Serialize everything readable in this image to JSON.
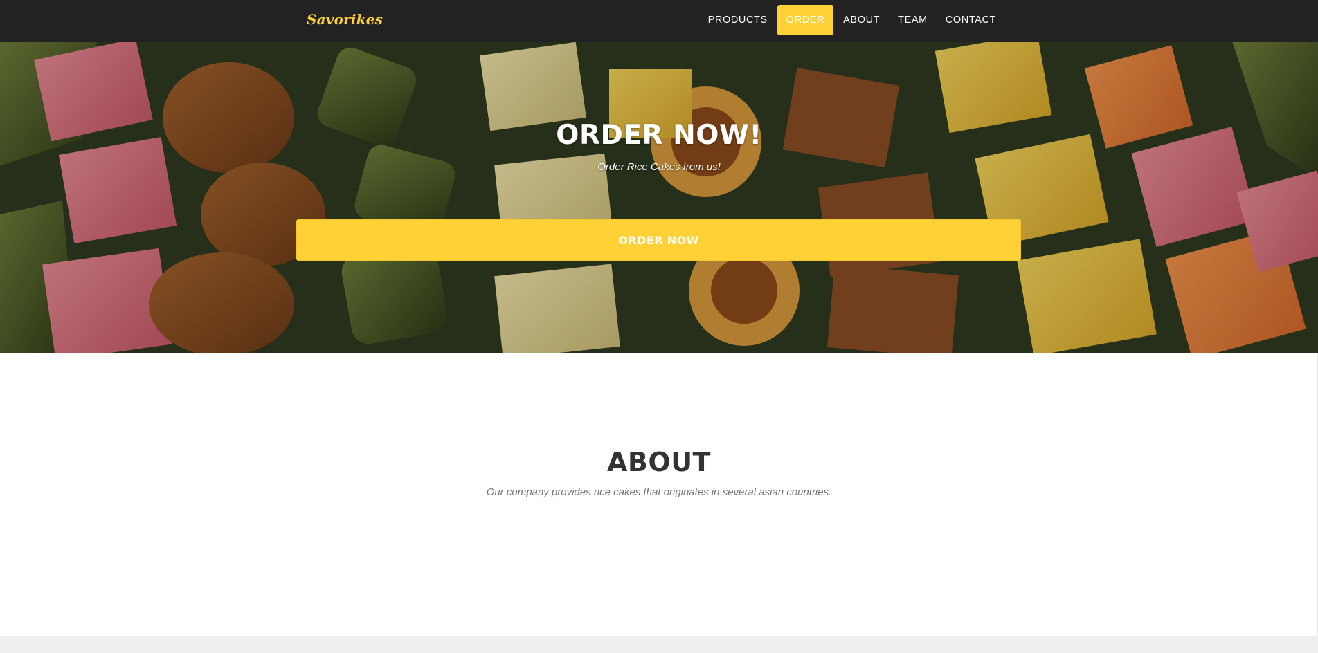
{
  "navbar": {
    "brand": "Savorikes",
    "items": [
      {
        "label": "PRODUCTS",
        "active": false
      },
      {
        "label": "ORDER",
        "active": true
      },
      {
        "label": "ABOUT",
        "active": false
      },
      {
        "label": "TEAM",
        "active": false
      },
      {
        "label": "CONTACT",
        "active": false
      }
    ]
  },
  "hero": {
    "title": "ORDER NOW!",
    "subtitle": "Order Rice Cakes from us!",
    "button_label": "ORDER NOW",
    "image": "rice-cakes-photo"
  },
  "about": {
    "title": "ABOUT",
    "text": "Our company provides rice cakes that originates in several asian countries."
  },
  "colors": {
    "accent": "#fed136",
    "navbar_bg": "#222222",
    "heading": "#333333",
    "muted_text": "#777777"
  }
}
